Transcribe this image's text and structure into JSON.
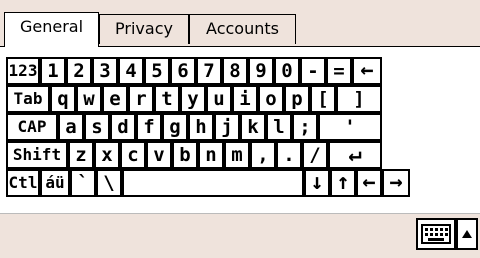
{
  "tabs": {
    "general": "General",
    "privacy": "Privacy",
    "accounts": "Accounts"
  },
  "keyboard": {
    "row1": [
      "123",
      "1",
      "2",
      "3",
      "4",
      "5",
      "6",
      "7",
      "8",
      "9",
      "0",
      "-",
      "=",
      "←"
    ],
    "row2": [
      "Tab",
      "q",
      "w",
      "e",
      "r",
      "t",
      "y",
      "u",
      "i",
      "o",
      "p",
      "[",
      "]"
    ],
    "row3": [
      "CAP",
      "a",
      "s",
      "d",
      "f",
      "g",
      "h",
      "j",
      "k",
      "l",
      ";",
      "'"
    ],
    "row4": [
      "Shift",
      "z",
      "x",
      "c",
      "v",
      "b",
      "n",
      "m",
      ",",
      ".",
      "/",
      "↵"
    ],
    "row5": [
      "Ctl",
      "áü",
      "`",
      "\\",
      "",
      "↓",
      "↑",
      "←",
      "→"
    ]
  },
  "bottombar": {
    "keyboard_icon": "keyboard-icon",
    "menu_arrow_icon": "up-arrow-icon"
  }
}
